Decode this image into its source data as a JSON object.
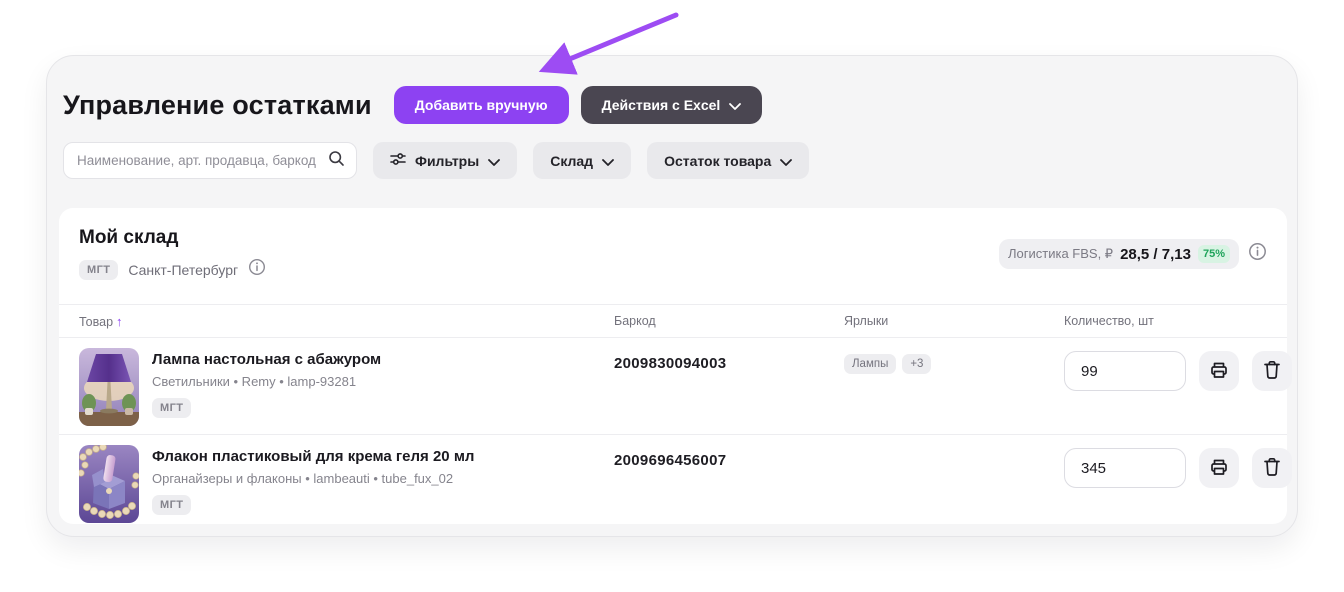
{
  "page": {
    "title": "Управление остатками"
  },
  "actions": {
    "add_manual": "Добавить вручную",
    "excel": "Действия с Excel"
  },
  "filters": {
    "search_placeholder": "Наименование, арт. продавца, баркод",
    "filters_label": "Фильтры",
    "warehouse_label": "Склад",
    "stock_label": "Остаток товара"
  },
  "warehouse": {
    "title": "Мой склад",
    "tag": "МГТ",
    "city": "Санкт-Петербург",
    "logistics": {
      "label": "Логистика FBS, ₽",
      "value": "28,5 / 7,13",
      "percent": "75%"
    }
  },
  "table": {
    "headers": {
      "product": "Товар",
      "barcode": "Баркод",
      "labels": "Ярлыки",
      "quantity": "Количество, шт"
    },
    "rows": [
      {
        "title": "Лампа настольная с абажуром",
        "subtitle": "Светильники • Remy • lamp-93281",
        "tag": "МГТ",
        "barcode": "2009830094003",
        "labels": [
          "Лампы",
          "+3"
        ],
        "quantity": "99"
      },
      {
        "title": "Флакон пластиковый для крема геля 20 мл",
        "subtitle": "Органайзеры и флаконы • lambeauti • tube_fux_02",
        "tag": "МГТ",
        "barcode": "2009696456007",
        "labels": [],
        "quantity": "345"
      }
    ]
  },
  "icons": {
    "sort_up": "↑",
    "chevron_down": "∨"
  },
  "colors": {
    "accent_purple": "#8d42f2",
    "dark_button": "#4a4651",
    "green_text": "#1ea35a",
    "green_bg": "#d8f3e3",
    "annotation_arrow": "#9d4cf3",
    "card_bg": "#f5f5f6",
    "chip_bg": "#e9e9ec"
  }
}
